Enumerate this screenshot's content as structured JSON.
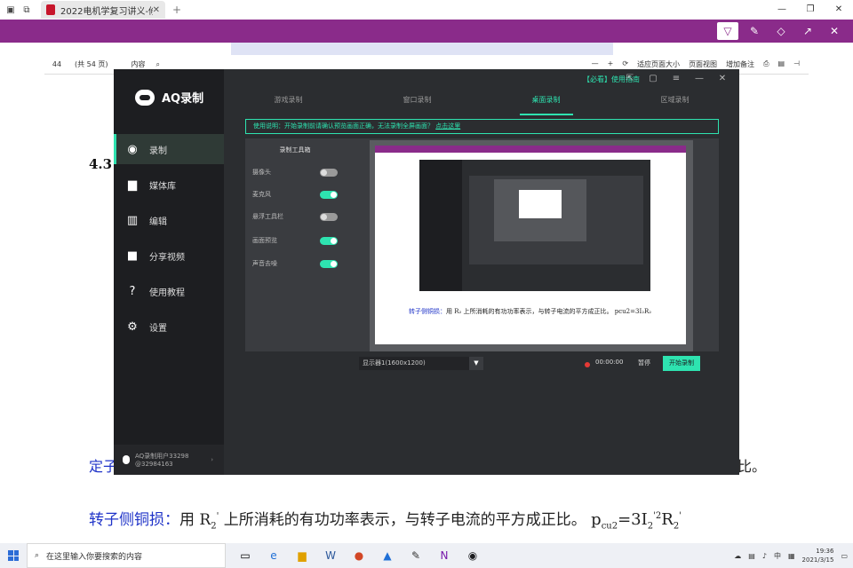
{
  "browser": {
    "tab_title": "2022电机学复习讲义-修",
    "new_tab": "+",
    "window_controls": [
      "—",
      "❐",
      "✕"
    ]
  },
  "pdf_toolbar": {
    "page_number": "44",
    "page_total": "(共 54 页)",
    "toc_label": "内容",
    "fit_label": "适应页面大小",
    "view_label": "页面视图",
    "notes_label": "增加备注"
  },
  "document": {
    "heading": "4.3",
    "line1_prefix": "定子",
    "line1_suffix": "比。",
    "line2_label": "转子侧铜损：",
    "line2_text_a": "用 R",
    "line2_text_b": " 上所消耗的有功功率表示，与转子电流的平方成正比。",
    "line2_formula_p": "p",
    "line2_formula_sub": "cu2",
    "line2_formula_rest": "=3I",
    "line2_formula_r": "R"
  },
  "recorder": {
    "app_name": "AQ录制",
    "nav": [
      {
        "label": "录制",
        "icon": "record-icon"
      },
      {
        "label": "媒体库",
        "icon": "media-icon"
      },
      {
        "label": "编辑",
        "icon": "edit-icon"
      },
      {
        "label": "分享视频",
        "icon": "share-video-icon"
      },
      {
        "label": "使用教程",
        "icon": "help-icon"
      },
      {
        "label": "设置",
        "icon": "gear-icon"
      }
    ],
    "user_name": "AQ录制用户33298",
    "user_id": "@32984163",
    "top_link": "【必看】使用指南",
    "tabs": [
      "游戏录制",
      "窗口录制",
      "桌面录制",
      "区域录制"
    ],
    "active_tab": 2,
    "notice": "使用说明：开始录制前请确认预览画面正确，无法录制全屏画面？",
    "notice_more": "点击这里",
    "toolbox_title": "录制工具箱",
    "toggles": [
      {
        "label": "摄像头",
        "on": false
      },
      {
        "label": "麦克风",
        "on": true
      },
      {
        "label": "悬浮工具栏",
        "on": false
      },
      {
        "label": "画面预览",
        "on": true
      },
      {
        "label": "声音去噪",
        "on": true
      }
    ],
    "display_select": "显示器1(1600x1200)",
    "rec_time": "00:00:00",
    "pause_label": "暂停",
    "start_label": "开始录制",
    "preview_text_label": "转子侧铜损：",
    "preview_text": "用 R₂ 上所消耗的有功功率表示，与转子电流的平方成正比。",
    "preview_formula": "pcu2=3I₂R₂",
    "accent": "#2ee3b0"
  },
  "taskbar": {
    "search_placeholder": "在这里输入你要搜索的内容",
    "time": "19:36",
    "date": "2021/3/15",
    "ime": "中"
  }
}
